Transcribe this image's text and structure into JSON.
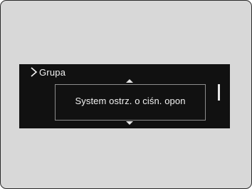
{
  "header": {
    "title": "Grupa",
    "chevron_icon": "chevron-right-icon"
  },
  "menu": {
    "selected_item": "System ostrz. o ciśn. opon",
    "scroll_up_icon": "arrow-up-icon",
    "scroll_down_icon": "arrow-down-icon"
  },
  "colors": {
    "screen_bg": "#111111",
    "text": "#f2f2f2",
    "frame_bg": "#d8d8d8",
    "highlight_border": "#8c8c8c"
  }
}
